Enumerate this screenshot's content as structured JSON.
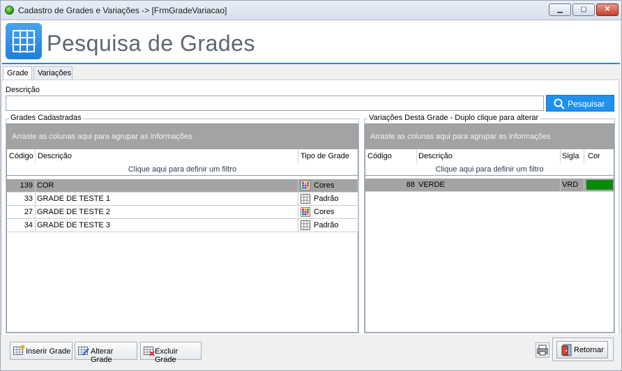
{
  "window": {
    "title": "Cadastro de Grades e Variações -> [FrmGradeVariacao]",
    "min_glyph": "▁",
    "max_glyph": "▢",
    "close_glyph": "✕"
  },
  "header": {
    "title": "Pesquisa de Grades",
    "icon": "grid-icon"
  },
  "tabs": [
    {
      "label": "Grade",
      "active": true
    },
    {
      "label": "Variações",
      "active": false
    }
  ],
  "search": {
    "label": "Descrição",
    "value": "",
    "button_label": "Pesquisar"
  },
  "grades": {
    "group_title": "Grades Cadastradas",
    "group_panel_text": "Arraste as colunas aqui para agrupar as informações",
    "columns": [
      "Código",
      "Descrição",
      "Tipo de Grade"
    ],
    "filter_text": "Clique aqui para definir um filtro",
    "rows": [
      {
        "codigo": "139",
        "descricao": "COR",
        "tipo": "Cores",
        "tipo_icon": "color-grid-icon",
        "selected": true
      },
      {
        "codigo": "33",
        "descricao": "GRADE DE TESTE 1",
        "tipo": "Padrão",
        "tipo_icon": "plain-grid-icon",
        "selected": false
      },
      {
        "codigo": "27",
        "descricao": "GRADE DE TESTE 2",
        "tipo": "Cores",
        "tipo_icon": "color-grid-icon",
        "selected": false
      },
      {
        "codigo": "34",
        "descricao": "GRADE DE TESTE 3",
        "tipo": "Padrão",
        "tipo_icon": "plain-grid-icon",
        "selected": false
      }
    ]
  },
  "variacoes": {
    "group_title": "Variações Desta Grade - Duplo clique para alterar",
    "group_panel_text": "Arraste as colunas aqui para agrupar as informações",
    "columns": [
      "Código",
      "Descrição",
      "Sigla",
      "Cor"
    ],
    "filter_text": "Clique aqui para definir um filtro",
    "rows": [
      {
        "codigo": "88",
        "descricao": "VERDE",
        "sigla": "VRD",
        "cor": "#088a08",
        "selected": true
      }
    ]
  },
  "toolbar": {
    "insert_label": "Inserir Grade",
    "alter_label": "Alterar Grade",
    "delete_label": "Excluir Grade",
    "return_label": "Retornar"
  },
  "colors": {
    "accent": "#1e90f0",
    "selected_row": "#a3a3a3",
    "group_panel": "#a3a3a3"
  }
}
